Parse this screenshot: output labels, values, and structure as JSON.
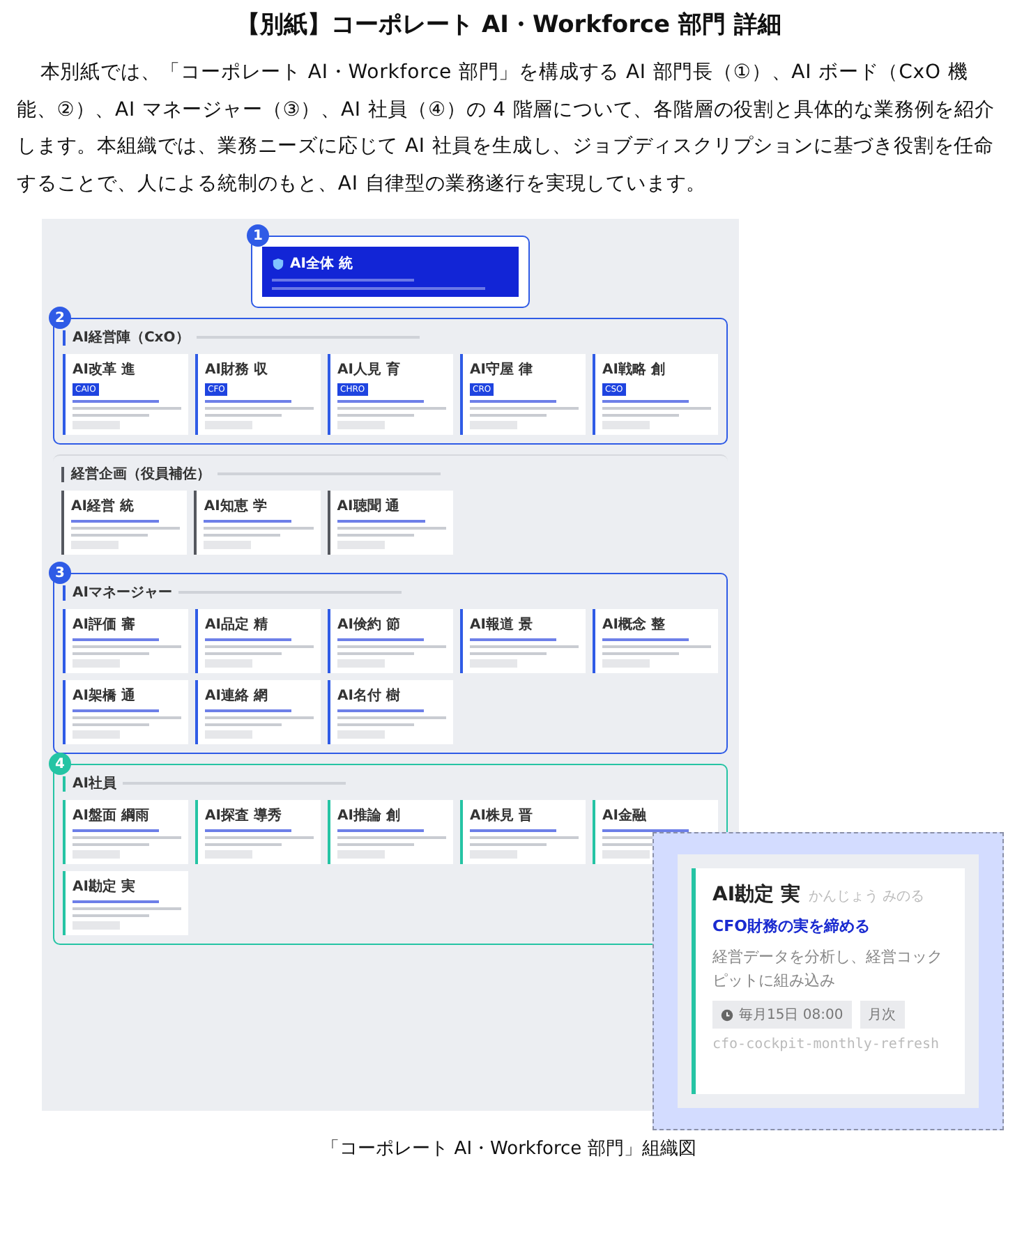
{
  "title": "【別紙】コーポレート AI・Workforce 部門 詳細",
  "intro": "本別紙では、「コーポレート AI・Workforce 部門」を構成する AI 部門長（①）、AI ボード（CxO 機能、②）、AI マネージャー（③）、AI 社員（④）の 4 階層について、各階層の役割と具体的な業務例を紹介します。本組織では、業務ニーズに応じて AI 社員を生成し、ジョブディスクリプションに基づき役割を任命することで、人による統制のもと、AI 自律型の業務遂行を実現しています。",
  "org_chart": {
    "top": {
      "badge": "1",
      "name": "AI全体 統"
    },
    "sections": [
      {
        "badge": "2",
        "framed": true,
        "color": "#2f5be6",
        "title": "AI経営陣（CxO）",
        "cards": [
          {
            "name": "AI改革 進",
            "role": "CAIO"
          },
          {
            "name": "AI財務 収",
            "role": "CFO"
          },
          {
            "name": "AI人見 育",
            "role": "CHRO"
          },
          {
            "name": "AI守屋 律",
            "role": "CRO"
          },
          {
            "name": "AI戦略 創",
            "role": "CSO"
          }
        ]
      },
      {
        "framed": false,
        "color": "#55585f",
        "title": "経営企画（役員補佐）",
        "cards": [
          {
            "name": "AI経営 統"
          },
          {
            "name": "AI知恵 学"
          },
          {
            "name": "AI聴聞 通"
          }
        ]
      },
      {
        "badge": "3",
        "framed": true,
        "color": "#2f5be6",
        "title": "AIマネージャー",
        "cards": [
          {
            "name": "AI評価 審"
          },
          {
            "name": "AI品定 精"
          },
          {
            "name": "AI倹約 節"
          },
          {
            "name": "AI報道 景"
          },
          {
            "name": "AI概念 整"
          },
          {
            "name": "AI架橋 通"
          },
          {
            "name": "AI連絡 網"
          },
          {
            "name": "AI名付 樹"
          }
        ]
      },
      {
        "badge": "4",
        "framed": true,
        "color": "#25c4a4",
        "title": "AI社員",
        "cards": [
          {
            "name": "AI盤面 綱雨"
          },
          {
            "name": "AI探査 導秀"
          },
          {
            "name": "AI推論 創"
          },
          {
            "name": "AI株見 晋"
          },
          {
            "name": "AI金融"
          },
          {
            "name": "AI勘定 実"
          }
        ]
      }
    ]
  },
  "zoom_callout": {
    "name": "AI勘定 実",
    "reading": "かんじょう みのる",
    "title": "CFO財務の実を締める",
    "description": "経営データを分析し、経営コックピットに組み込み",
    "schedule": "毎月15日 08:00",
    "frequency": "月次",
    "slug": "cfo-cockpit-monthly-refresh"
  },
  "caption": "「コーポレート AI・Workforce 部門」組織図"
}
